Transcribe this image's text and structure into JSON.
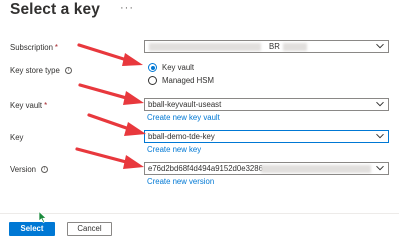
{
  "header": {
    "title": "Select a key",
    "more_label": "···"
  },
  "subscription": {
    "label": "Subscription",
    "required_mark": "*",
    "value_suffix": "BR"
  },
  "key_store_type": {
    "label": "Key store type",
    "options": [
      {
        "label": "Key vault",
        "selected": true
      },
      {
        "label": "Managed HSM",
        "selected": false
      }
    ]
  },
  "key_vault": {
    "label": "Key vault",
    "required_mark": "*",
    "value": "bball-keyvault-useast",
    "create_link": "Create new key vault"
  },
  "key": {
    "label": "Key",
    "value": "bball-demo-tde-key",
    "create_link": "Create new key"
  },
  "version": {
    "label": "Version",
    "value": "e76d2bd68f4d494a9152d0e3286",
    "create_link": "Create new version"
  },
  "footer": {
    "select_label": "Select",
    "cancel_label": "Cancel"
  },
  "colors": {
    "accent": "#0078d4",
    "arrow": "#e8383d",
    "required": "#a4262c"
  },
  "icons": [
    "more-icon",
    "info-icon",
    "chevron-down-icon",
    "cursor-icon"
  ]
}
